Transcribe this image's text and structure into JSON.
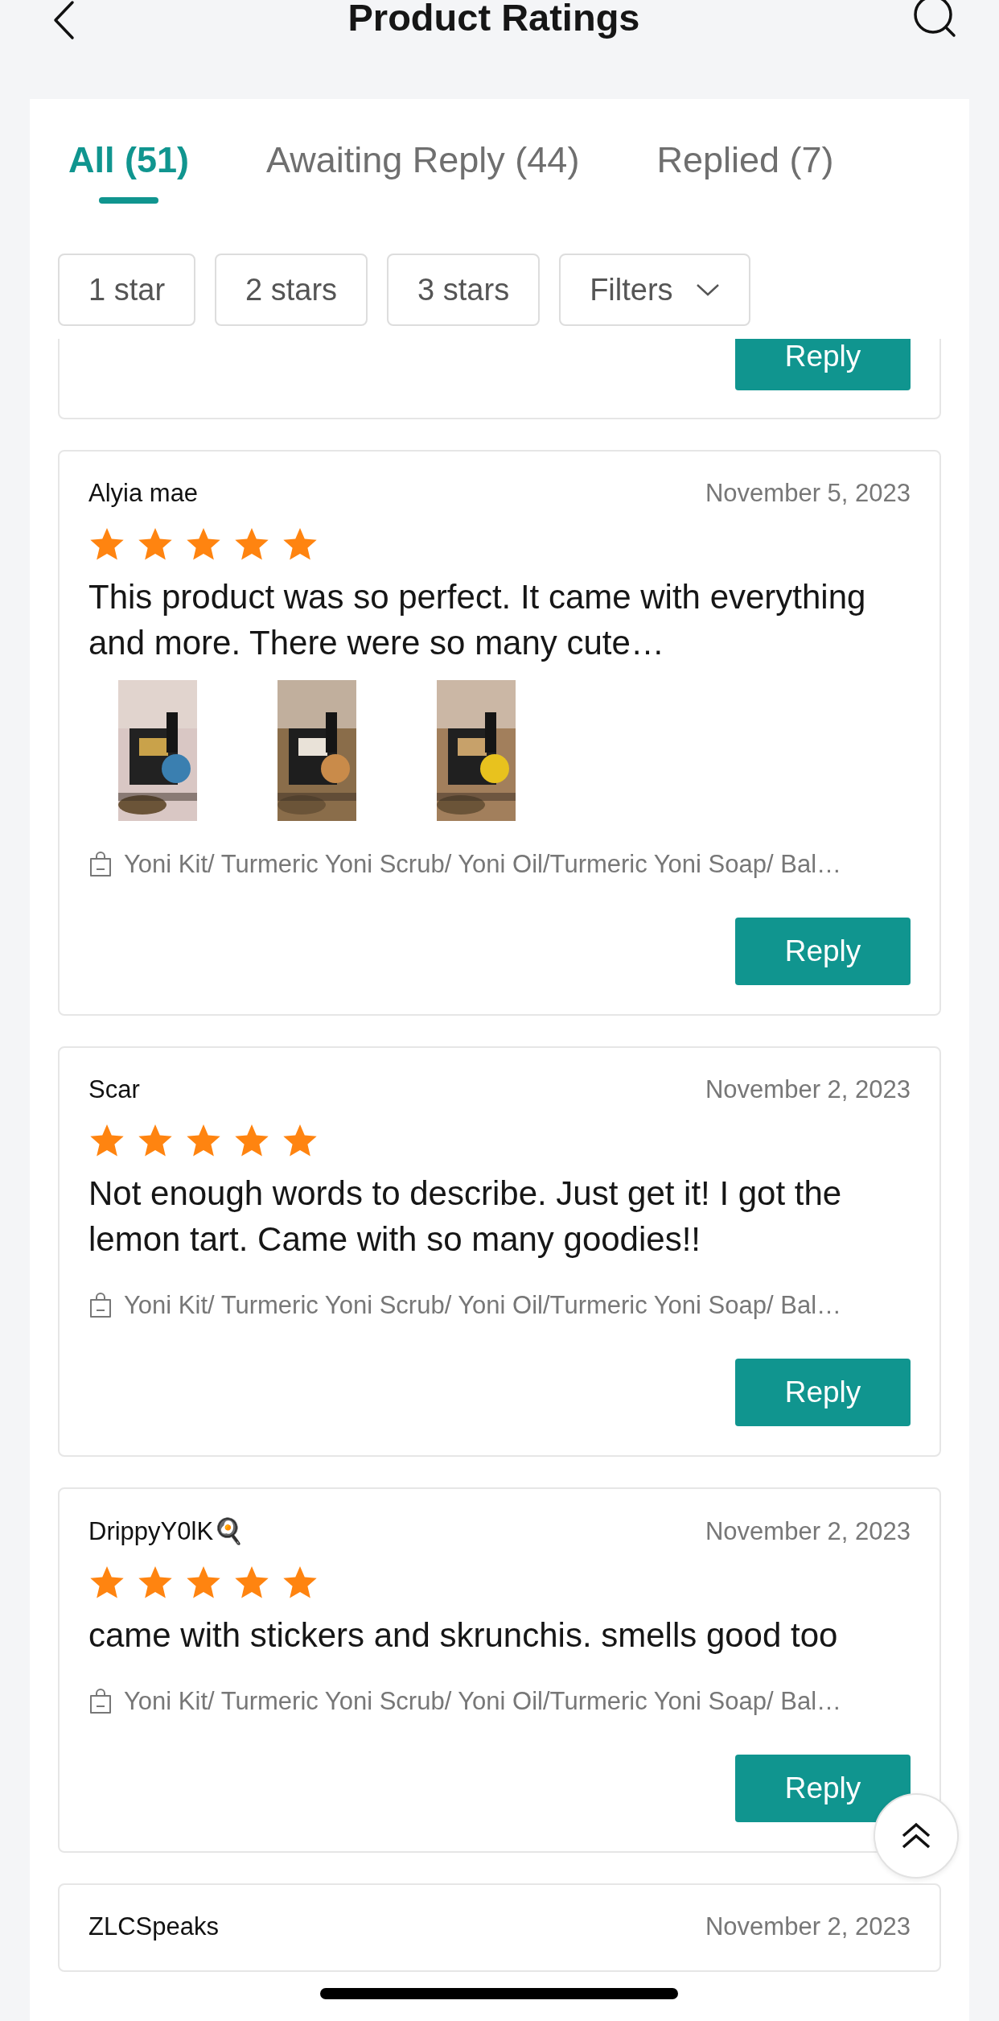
{
  "header": {
    "title": "Product Ratings"
  },
  "tabs": [
    {
      "label": "All (51)",
      "selected": true
    },
    {
      "label": "Awaiting Reply (44)",
      "selected": false
    },
    {
      "label": "Replied (7)",
      "selected": false
    }
  ],
  "filters": [
    {
      "label": "1 star",
      "kind": "chip"
    },
    {
      "label": "2 stars",
      "kind": "chip"
    },
    {
      "label": "3 stars",
      "kind": "chip"
    },
    {
      "label": "Filters",
      "kind": "dropdown"
    }
  ],
  "partial_card": {
    "reply": "Reply"
  },
  "reviews": [
    {
      "name": "Alyia mae",
      "date": "November 5, 2023",
      "stars": 5,
      "text": "This product was so perfect. It came with everything and more. There were so many cute…",
      "images": [
        {
          "kind": "picture"
        },
        {
          "kind": "picture"
        },
        {
          "kind": "picture"
        }
      ],
      "product": "Yoni Kit/ Turmeric Yoni Scrub/ Yoni Oil/Turmeric Yoni Soap/ Bal…",
      "reply": "Reply"
    },
    {
      "name": "Scar",
      "date": "November 2, 2023",
      "stars": 5,
      "text": "Not enough words to describe. Just get it! I got the lemon tart. Came with so many goodies!!",
      "product": "Yoni Kit/ Turmeric Yoni Scrub/ Yoni Oil/Turmeric Yoni Soap/ Bal…",
      "reply": "Reply"
    },
    {
      "name": "DrippyY0lK🍳",
      "date": "November 2, 2023",
      "stars": 5,
      "text": "came with stickers and skrunchis. smells good too",
      "product": "Yoni Kit/ Turmeric Yoni Scrub/ Yoni Oil/Turmeric Yoni Soap/ Bal…",
      "reply": "Reply"
    },
    {
      "name": "ZLCSpeaks",
      "date": "November 2, 2023"
    }
  ]
}
